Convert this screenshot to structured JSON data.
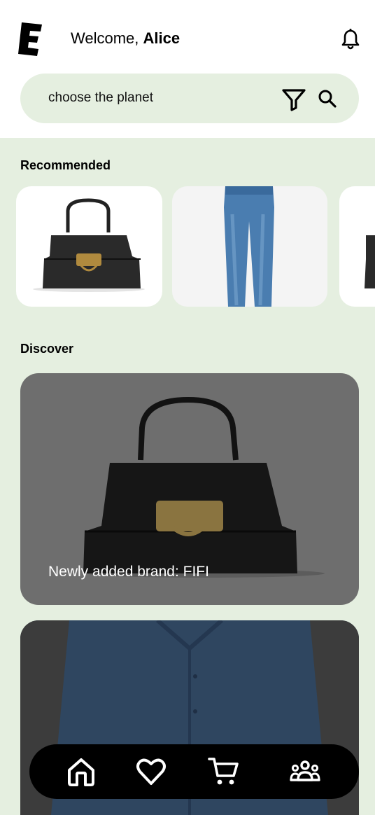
{
  "header": {
    "logo_icon": "brand-e-logo",
    "welcome_prefix": "Welcome, ",
    "user_name": "Alice",
    "notification_icon": "bell-icon"
  },
  "search": {
    "placeholder": "choose the planet",
    "filter_icon": "filter-icon",
    "search_icon": "search-icon"
  },
  "recommended": {
    "title": "Recommended",
    "items": [
      {
        "image": "black handbag"
      },
      {
        "image": "blue jeans"
      },
      {
        "image": "black handbag"
      }
    ]
  },
  "discover": {
    "title": "Discover",
    "cards": [
      {
        "caption": "Newly added brand: FIFI",
        "image": "black handbag"
      },
      {
        "caption": "",
        "image": "blue shirt"
      }
    ]
  },
  "nav": {
    "items": [
      {
        "icon": "home-icon"
      },
      {
        "icon": "heart-icon"
      },
      {
        "icon": "cart-icon"
      },
      {
        "icon": "community-icon"
      }
    ]
  },
  "colors": {
    "background": "#e5efe0",
    "search_bg": "#e5efe0",
    "nav_bg": "#000000",
    "overlay": "#6e6e6e"
  }
}
